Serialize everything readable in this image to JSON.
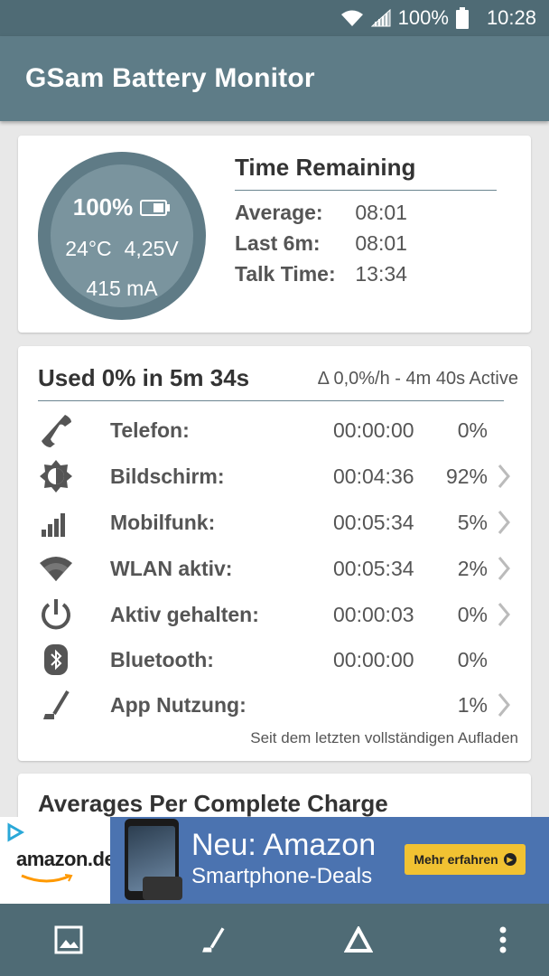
{
  "status_bar": {
    "battery_percent": "100%",
    "time": "10:28",
    "icons": [
      "wifi-icon",
      "signal-icon",
      "battery-icon"
    ]
  },
  "app": {
    "title": "GSam Battery Monitor"
  },
  "battery": {
    "percent": "100%",
    "temperature": "24°C",
    "voltage": "4,25V",
    "current": "415 mA",
    "level": 1.0
  },
  "time_remaining": {
    "title": "Time Remaining",
    "rows": [
      {
        "label": "Average:",
        "value": "08:01"
      },
      {
        "label": "Last 6m:",
        "value": "08:01"
      },
      {
        "label": "Talk Time:",
        "value": "13:34"
      }
    ]
  },
  "usage": {
    "title": "Used 0% in 5m 34s",
    "rate": "Δ 0,0%/h - 4m 40s Active",
    "rows": [
      {
        "icon": "phone-icon",
        "name": "Telefon:",
        "time": "00:00:00",
        "percent": "0%",
        "has_chevron": false
      },
      {
        "icon": "brightness-icon",
        "name": "Bildschirm:",
        "time": "00:04:36",
        "percent": "92%",
        "has_chevron": true
      },
      {
        "icon": "signal-bars-icon",
        "name": "Mobilfunk:",
        "time": "00:05:34",
        "percent": "5%",
        "has_chevron": true
      },
      {
        "icon": "wifi-icon",
        "name": "WLAN aktiv:",
        "time": "00:05:34",
        "percent": "2%",
        "has_chevron": true
      },
      {
        "icon": "power-icon",
        "name": "Aktiv gehalten:",
        "time": "00:00:03",
        "percent": "0%",
        "has_chevron": true
      },
      {
        "icon": "bluetooth-icon",
        "name": "Bluetooth:",
        "time": "00:00:00",
        "percent": "0%",
        "has_chevron": false
      },
      {
        "icon": "app-usage-icon",
        "name": "App Nutzung:",
        "time": "",
        "percent": "1%",
        "has_chevron": true
      }
    ],
    "footnote": "Seit dem letzten vollständigen Aufladen"
  },
  "averages": {
    "title": "Averages Per Complete Charge"
  },
  "ad": {
    "brand": "amazon.de",
    "headline": "Neu: Amazon",
    "subline": "Smartphone-Deals",
    "cta": "Mehr erfahren"
  },
  "nav": {
    "items": [
      "image-icon",
      "app-usage-icon",
      "delta-icon",
      "more-vert-icon"
    ]
  },
  "colors": {
    "primary": "#5e7c87",
    "primary_dark": "#4f6b75",
    "gauge_inner": "#7a949e",
    "ad_blue": "#4b73b0",
    "ad_button": "#f1c232"
  }
}
